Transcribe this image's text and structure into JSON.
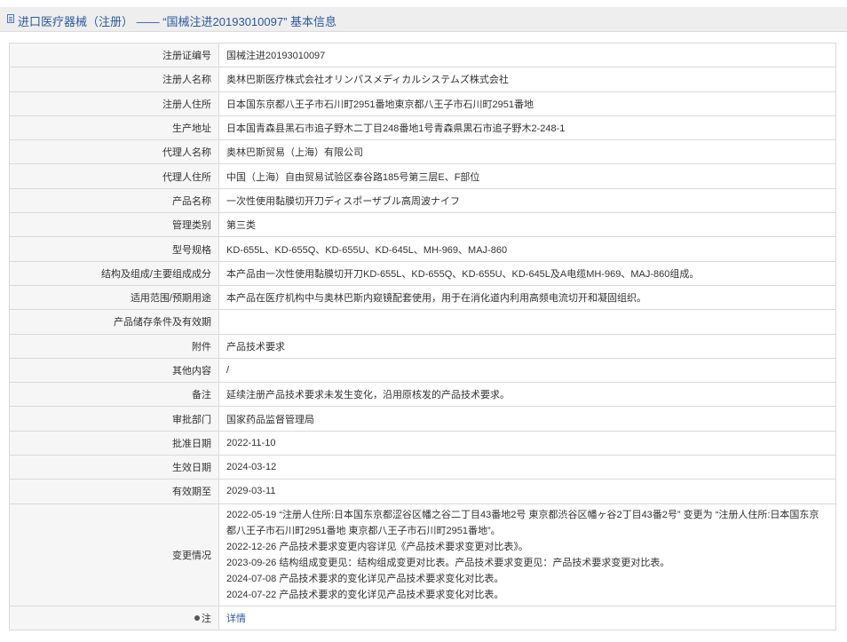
{
  "title": "进口医疗器械（注册） —— “国械注进20193010097” 基本信息",
  "rows": [
    {
      "label": "注册证编号",
      "value": "国械注进20193010097"
    },
    {
      "label": "注册人名称",
      "value": "奥林巴斯医疗株式会社オリンパスメディカルシステムズ株式会社"
    },
    {
      "label": "注册人住所",
      "value": "日本国东京都八王子市石川町2951番地東京都八王子市石川町2951番地"
    },
    {
      "label": "生产地址",
      "value": "日本国青森县黑石市追子野木二丁目248番地1号青森県黒石市追子野木2-248-1"
    },
    {
      "label": "代理人名称",
      "value": "奥林巴斯贸易（上海）有限公司"
    },
    {
      "label": "代理人住所",
      "value": "中国（上海）自由贸易试验区泰谷路185号第三层E、F部位"
    },
    {
      "label": "产品名称",
      "value": "一次性使用黏膜切开刀ディスポーザブル高周波ナイフ"
    },
    {
      "label": "管理类别",
      "value": "第三类"
    },
    {
      "label": "型号规格",
      "value": "KD-655L、KD-655Q、KD-655U、KD-645L、MH-969、MAJ-860"
    },
    {
      "label": "结构及组成/主要组成成分",
      "value": "本产品由一次性使用黏膜切开刀KD-655L、KD-655Q、KD-655U、KD-645L及A电缆MH-969、MAJ-860组成。"
    },
    {
      "label": "适用范围/预期用途",
      "value": "本产品在医疗机构中与奥林巴斯内窥镜配套使用，用于在消化道内利用高频电流切开和凝固组织。"
    },
    {
      "label": "产品储存条件及有效期",
      "value": ""
    },
    {
      "label": "附件",
      "value": "产品技术要求"
    },
    {
      "label": "其他内容",
      "value": "/"
    },
    {
      "label": "备注",
      "value": "延续注册产品技术要求未发生变化，沿用原核发的产品技术要求。"
    },
    {
      "label": "审批部门",
      "value": "国家药品监督管理局"
    },
    {
      "label": "批准日期",
      "value": "2022-11-10"
    },
    {
      "label": "生效日期",
      "value": "2024-03-12"
    },
    {
      "label": "有效期至",
      "value": "2029-03-11"
    }
  ],
  "changes": {
    "label": "变更情况",
    "lines": [
      "2022-05-19 “注册人住所:日本国东京都涩谷区幡之谷二丁目43番地2号 東京都渋谷区幡ヶ谷2丁目43番2号” 变更为 “注册人住所:日本国东京都八王子市石川町2951番地 東京都八王子市石川町2951番地”。",
      "2022-12-26 产品技术要求变更内容详见《产品技术要求变更对比表》。",
      "2023-09-26 结构组成变更见：结构组成变更对比表。产品技术要求变更见：产品技术要求变更对比表。",
      "2024-07-08 产品技术要求的变化详见产品技术要求变化对比表。",
      "2024-07-22 产品技术要求的变化详见产品技术要求变化对比表。"
    ]
  },
  "note": {
    "label": "注",
    "link": "详情"
  }
}
